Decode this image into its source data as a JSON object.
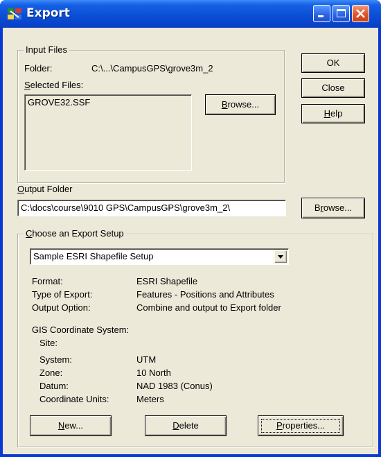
{
  "window": {
    "title": "Export"
  },
  "input_files": {
    "legend": "Input Files",
    "folder_label": "Folder:",
    "folder_value": "C:\\...\\CampusGPS\\grove3m_2",
    "selected_label": "Selected Files:",
    "files": [
      "GROVE32.SSF"
    ],
    "browse_label": "Browse..."
  },
  "side_buttons": {
    "ok": "OK",
    "close": "Close",
    "help": "Help"
  },
  "output_folder": {
    "label": "Output Folder",
    "value": "C:\\docs\\course\\9010 GPS\\CampusGPS\\grove3m_2\\",
    "browse_label": "Browse..."
  },
  "setup": {
    "legend": "Choose an Export Setup",
    "selected": "Sample ESRI Shapefile Setup",
    "format_label": "Format:",
    "format_value": "ESRI Shapefile",
    "type_label": "Type of Export:",
    "type_value": "Features - Positions and Attributes",
    "output_label": "Output Option:",
    "output_value": "Combine and output to Export folder",
    "gis_label": "GIS Coordinate System:",
    "site_label": "Site:",
    "site_value": "",
    "system_label": "System:",
    "system_value": "UTM",
    "zone_label": "Zone:",
    "zone_value": "10 North",
    "datum_label": "Datum:",
    "datum_value": "NAD 1983 (Conus)",
    "units_label": "Coordinate Units:",
    "units_value": "Meters",
    "new_label": "New...",
    "delete_label": "Delete",
    "properties_label": "Properties..."
  },
  "colors": {
    "titlebar": "#0a4fd6",
    "dialog_bg": "#ece9d8",
    "close_btn": "#e0532b"
  }
}
